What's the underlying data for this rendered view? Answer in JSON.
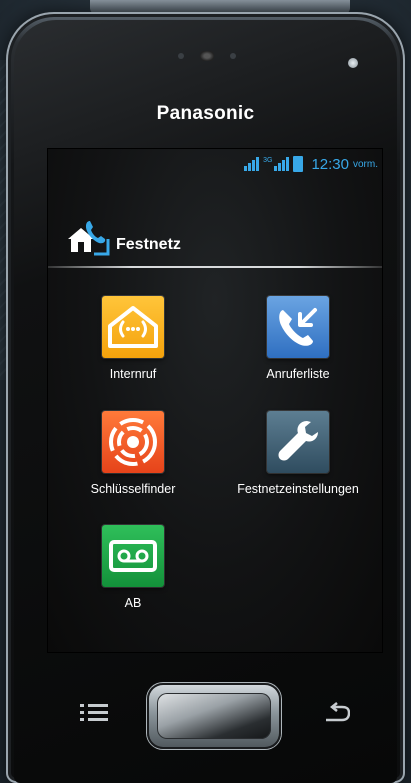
{
  "device": {
    "brand": "Panasonic"
  },
  "status_bar": {
    "network_badge": "3G",
    "time": "12:30",
    "ampm": "vorm.",
    "accent_color": "#38a8e8"
  },
  "section": {
    "title": "Festnetz",
    "icon": "home-phone-icon"
  },
  "apps": [
    {
      "label": "Internruf",
      "icon": "intercom-house-icon",
      "color": "#f4a20c"
    },
    {
      "label": "Anruferliste",
      "icon": "call-log-icon",
      "color": "#2f6fc1"
    },
    {
      "label": "Schlüsselfinder",
      "icon": "key-finder-icon",
      "color": "#e6431a"
    },
    {
      "label": "Festnetzeinstellungen",
      "icon": "wrench-icon",
      "color": "#2f4c5f"
    },
    {
      "label": "AB",
      "icon": "voicemail-icon",
      "color": "#13913a"
    }
  ],
  "hardware_keys": {
    "menu": "menu-icon",
    "home": "home-button",
    "back": "back-icon"
  }
}
